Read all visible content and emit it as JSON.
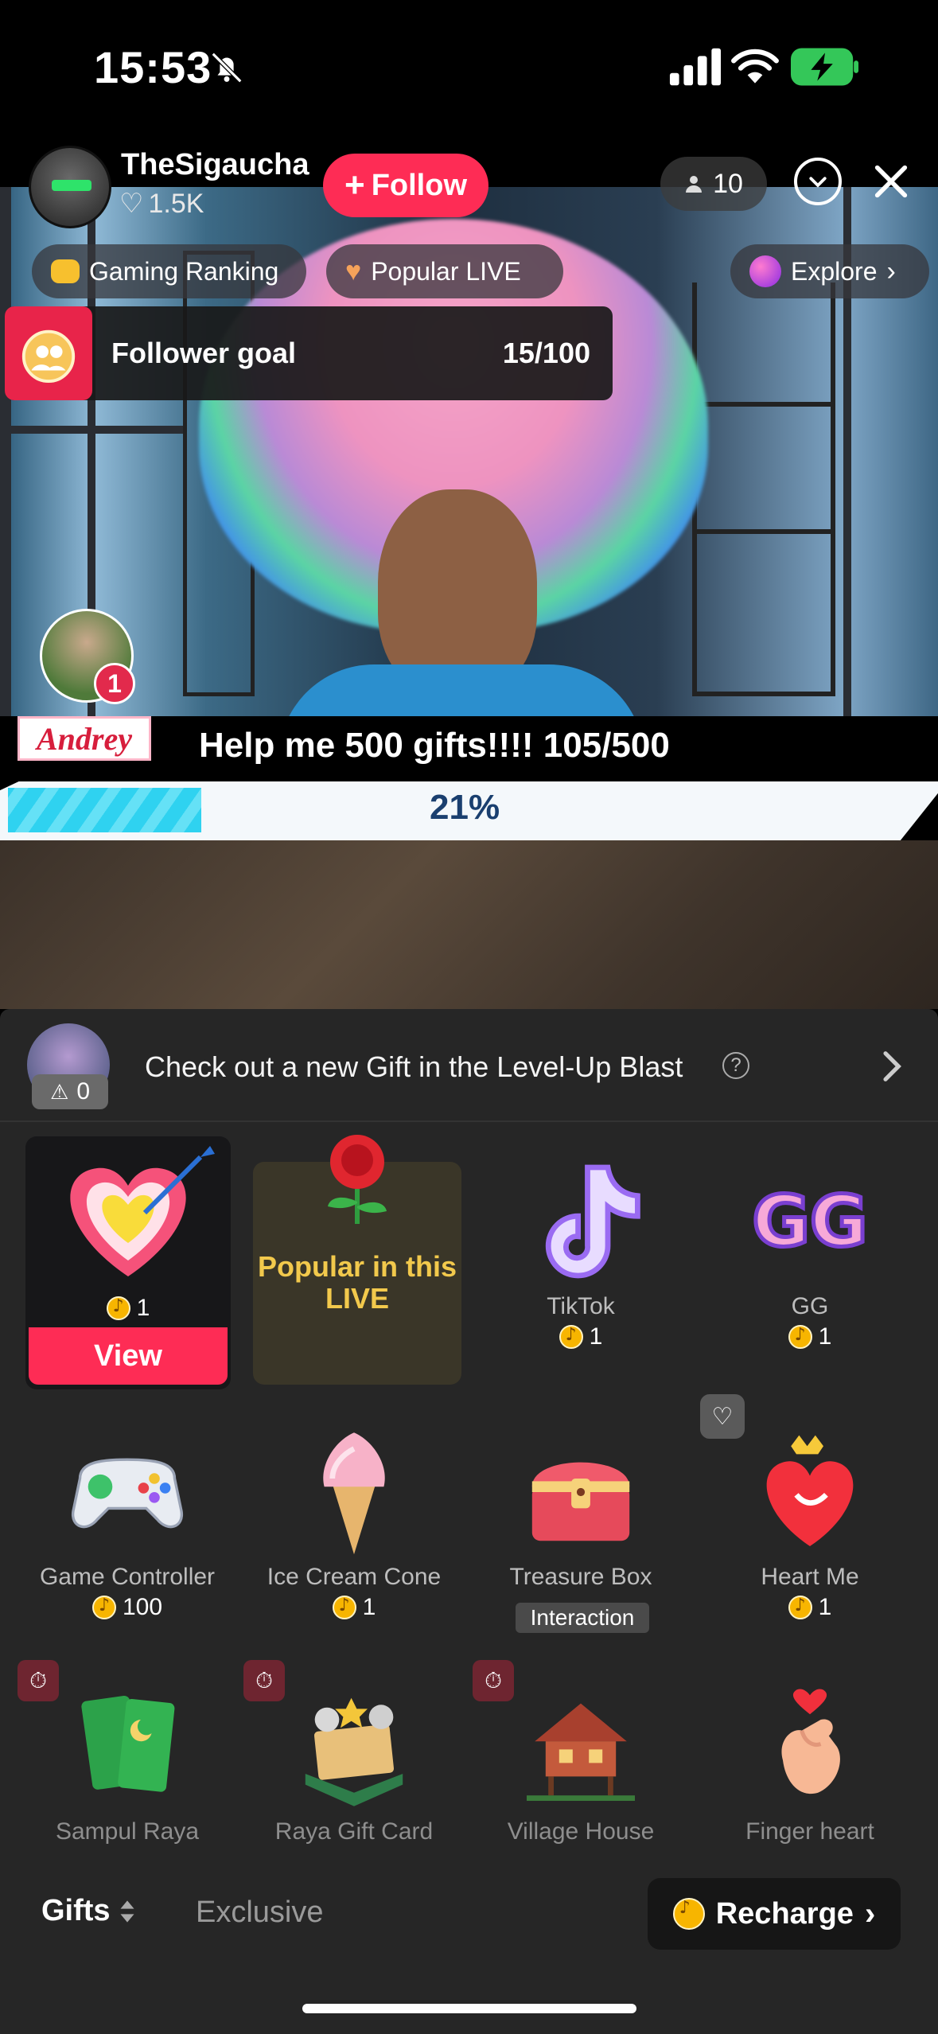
{
  "status_bar": {
    "time": "15:53",
    "icons": [
      "bell-off-icon",
      "signal-icon",
      "wifi-icon",
      "battery-charging-icon"
    ]
  },
  "host": {
    "name": "TheSigaucha",
    "likes": "1.5K",
    "follow_label": "Follow"
  },
  "viewers": {
    "count": "10"
  },
  "top_pills": {
    "gaming": "Gaming Ranking",
    "popular": "Popular LIVE",
    "explore": "Explore"
  },
  "follower_goal": {
    "label": "Follower goal",
    "progress": "15/100"
  },
  "guest": {
    "badge": "1",
    "tag": "Andrey"
  },
  "gift_goal": {
    "text": "Help me 500 gifts!!!!  105/500",
    "percent_label": "21%",
    "percent": 21
  },
  "blast": {
    "count": "0",
    "text": "Check out a new Gift in the Level-Up Blast",
    "help": "?"
  },
  "gifts_row1": [
    {
      "name": "",
      "price": "1",
      "action": "View"
    },
    {
      "name": "Popular in this LIVE"
    },
    {
      "name": "TikTok",
      "price": "1"
    },
    {
      "name": "GG",
      "price": "1"
    }
  ],
  "gifts_row2": [
    {
      "name": "Game Controller",
      "price": "100"
    },
    {
      "name": "Ice Cream Cone",
      "price": "1"
    },
    {
      "name": "Treasure Box",
      "tag": "Interaction"
    },
    {
      "name": "Heart Me",
      "price": "1"
    }
  ],
  "gifts_row3": [
    {
      "name": "Sampul Raya"
    },
    {
      "name": "Raya Gift Card"
    },
    {
      "name": "Village House"
    },
    {
      "name": "Finger heart"
    }
  ],
  "bottom_bar": {
    "gifts_tab": "Gifts",
    "exclusive_tab": "Exclusive",
    "recharge": "Recharge"
  },
  "colors": {
    "accent": "#fe2c55",
    "panel": "#262626",
    "coin": "#f7b500",
    "popular_text": "#f2c94c"
  }
}
